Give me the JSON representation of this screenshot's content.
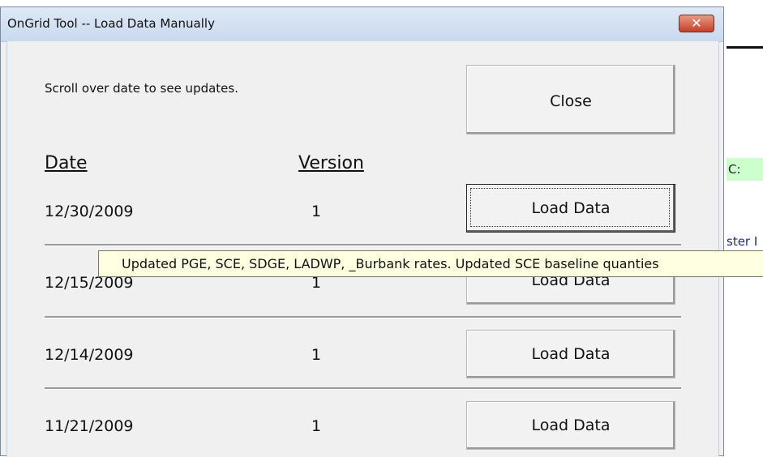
{
  "background": {
    "cell_text_c": "C:",
    "cell_text_ster": "ster I"
  },
  "window": {
    "title": "OnGrid Tool -- Load Data Manually",
    "close_glyph": "✕"
  },
  "dialog": {
    "hint": "Scroll over date to see updates.",
    "close_button": "Close",
    "col_date": "Date",
    "col_version": "Version",
    "rows": [
      {
        "date": "12/30/2009",
        "version": "1",
        "button": "Load Data"
      },
      {
        "date": "12/15/2009",
        "version": "1",
        "button": "Load Data"
      },
      {
        "date": "12/14/2009",
        "version": "1",
        "button": "Load Data"
      },
      {
        "date": "11/21/2009",
        "version": "1",
        "button": "Load Data"
      }
    ],
    "tooltip": "Updated PGE, SCE, SDGE, LADWP, _Burbank rates. Updated SCE baseline quanties"
  },
  "colors": {
    "titlebar": "#c9d9ee",
    "close_red": "#c4412a",
    "tooltip_bg": "#ffffe1",
    "dialog_bg": "#f0f0f0"
  }
}
